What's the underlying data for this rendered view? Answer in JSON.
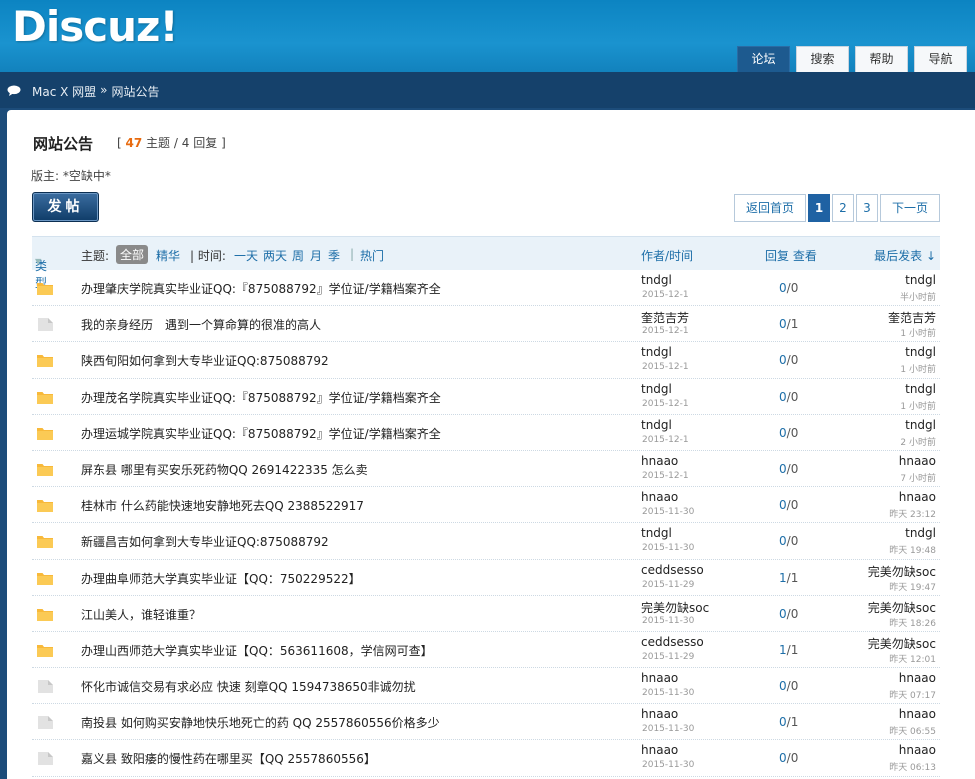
{
  "header": {
    "logo": "Discuz!",
    "nav": [
      "论坛",
      "搜索",
      "帮助",
      "导航"
    ]
  },
  "breadcrumb": {
    "site": "Mac X 网盟",
    "sep": "»",
    "current": "网站公告"
  },
  "forum": {
    "title": "网站公告",
    "stats_open": "[",
    "topics": "47",
    "topics_label": "主题",
    "slash": "/",
    "replies": "4",
    "replies_label": "回复",
    "stats_close": "]",
    "moderators": "版主: *空缺中*",
    "post_button": "发帖"
  },
  "pager": {
    "back": "返回首页",
    "pages": [
      "1",
      "2",
      "3"
    ],
    "current": "1",
    "next": "下一页"
  },
  "table_header": {
    "type": "类型",
    "theme_label": "主题:",
    "all": "全部",
    "digest": "精华",
    "time_label": "| 时间:",
    "times": [
      "一天",
      "两天",
      "周",
      "月",
      "季"
    ],
    "hot_sep": "|",
    "hot": "热门",
    "author_time": "作者/时间",
    "reply_view": "回复 查看",
    "last_post": "最后发表 ↓"
  },
  "threads": [
    {
      "icon": "folder",
      "title": "办理肇庆学院真实毕业证QQ:『875088792』学位证/学籍档案齐全",
      "author": "tndgl",
      "date": "2015-12-1",
      "replies": "0",
      "sep": "/",
      "views": "0",
      "last": "tndgl",
      "last_time": "半小时前"
    },
    {
      "icon": "doc",
      "title": "我的亲身经历　遇到一个算命算的很准的高人",
      "author": "奎范吉芳",
      "date": "2015-12-1",
      "replies": "0",
      "sep": "/",
      "views": "1",
      "last": "奎范吉芳",
      "last_time": "1 小时前"
    },
    {
      "icon": "folder",
      "title": "陕西旬阳如何拿到大专毕业证QQ:875088792",
      "author": "tndgl",
      "date": "2015-12-1",
      "replies": "0",
      "sep": "/",
      "views": "0",
      "last": "tndgl",
      "last_time": "1 小时前"
    },
    {
      "icon": "folder",
      "title": "办理茂名学院真实毕业证QQ:『875088792』学位证/学籍档案齐全",
      "author": "tndgl",
      "date": "2015-12-1",
      "replies": "0",
      "sep": "/",
      "views": "0",
      "last": "tndgl",
      "last_time": "1 小时前"
    },
    {
      "icon": "folder",
      "title": "办理运城学院真实毕业证QQ:『875088792』学位证/学籍档案齐全",
      "author": "tndgl",
      "date": "2015-12-1",
      "replies": "0",
      "sep": "/",
      "views": "0",
      "last": "tndgl",
      "last_time": "2 小时前"
    },
    {
      "icon": "folder",
      "title": "屏东县 哪里有买安乐死药物QQ 2691422335 怎么卖",
      "author": "hnaao",
      "date": "2015-12-1",
      "replies": "0",
      "sep": "/",
      "views": "0",
      "last": "hnaao",
      "last_time": "7 小时前"
    },
    {
      "icon": "folder",
      "title": "桂林市 什么药能快速地安静地死去QQ 2388522917",
      "author": "hnaao",
      "date": "2015-11-30",
      "replies": "0",
      "sep": "/",
      "views": "0",
      "last": "hnaao",
      "last_time": "昨天 23:12"
    },
    {
      "icon": "folder",
      "title": "新疆昌吉如何拿到大专毕业证QQ:875088792",
      "author": "tndgl",
      "date": "2015-11-30",
      "replies": "0",
      "sep": "/",
      "views": "0",
      "last": "tndgl",
      "last_time": "昨天 19:48"
    },
    {
      "icon": "folder",
      "title": "办理曲阜师范大学真实毕业证【QQ：750229522】",
      "author": "ceddsesso",
      "date": "2015-11-29",
      "replies": "1",
      "sep": "/",
      "views": "1",
      "last": "完美勿缺soc",
      "last_time": "昨天 19:47"
    },
    {
      "icon": "folder",
      "title": "江山美人，谁轻谁重？",
      "author": "完美勿缺soc",
      "date": "2015-11-30",
      "replies": "0",
      "sep": "/",
      "views": "0",
      "last": "完美勿缺soc",
      "last_time": "昨天 18:26"
    },
    {
      "icon": "folder",
      "title": "办理山西师范大学真实毕业证【QQ：563611608，学信网可查】",
      "author": "ceddsesso",
      "date": "2015-11-29",
      "replies": "1",
      "sep": "/",
      "views": "1",
      "last": "完美勿缺soc",
      "last_time": "昨天 12:01"
    },
    {
      "icon": "doc",
      "title": "怀化市诚信交易有求必应 快速 刻章QQ 1594738650非诚勿扰",
      "author": "hnaao",
      "date": "2015-11-30",
      "replies": "0",
      "sep": "/",
      "views": "0",
      "last": "hnaao",
      "last_time": "昨天 07:17"
    },
    {
      "icon": "doc",
      "title": "南投县 如何购买安静地快乐地死亡的药 QQ 2557860556价格多少",
      "author": "hnaao",
      "date": "2015-11-30",
      "replies": "0",
      "sep": "/",
      "views": "1",
      "last": "hnaao",
      "last_time": "昨天 06:55"
    },
    {
      "icon": "doc",
      "title": "嘉义县 致阳痿的慢性药在哪里买【QQ 2557860556】",
      "author": "hnaao",
      "date": "2015-11-30",
      "replies": "0",
      "sep": "/",
      "views": "0",
      "last": "hnaao",
      "last_time": "昨天 06:13"
    }
  ]
}
